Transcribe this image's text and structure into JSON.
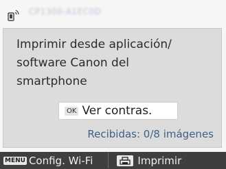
{
  "header": {
    "device_name": "CP1300-A1EC0D",
    "icon": "smartphone-wifi-icon"
  },
  "dialog": {
    "message_lines": [
      "Imprimir desde aplicación/",
      "software Canon del",
      "smartphone"
    ],
    "ok_key": "OK",
    "ok_label": "Ver contras.",
    "received": "Recibidas: 0/8 imágenes"
  },
  "footer": {
    "menu_key": "MENU",
    "menu_label": "Config. Wi-Fi",
    "print_icon": "print-icon",
    "print_label": "Imprimir"
  },
  "colors": {
    "panel_bg": "#dcdcdc",
    "footer_bg": "#3f3f3f",
    "accent_text": "#3d5f86"
  }
}
